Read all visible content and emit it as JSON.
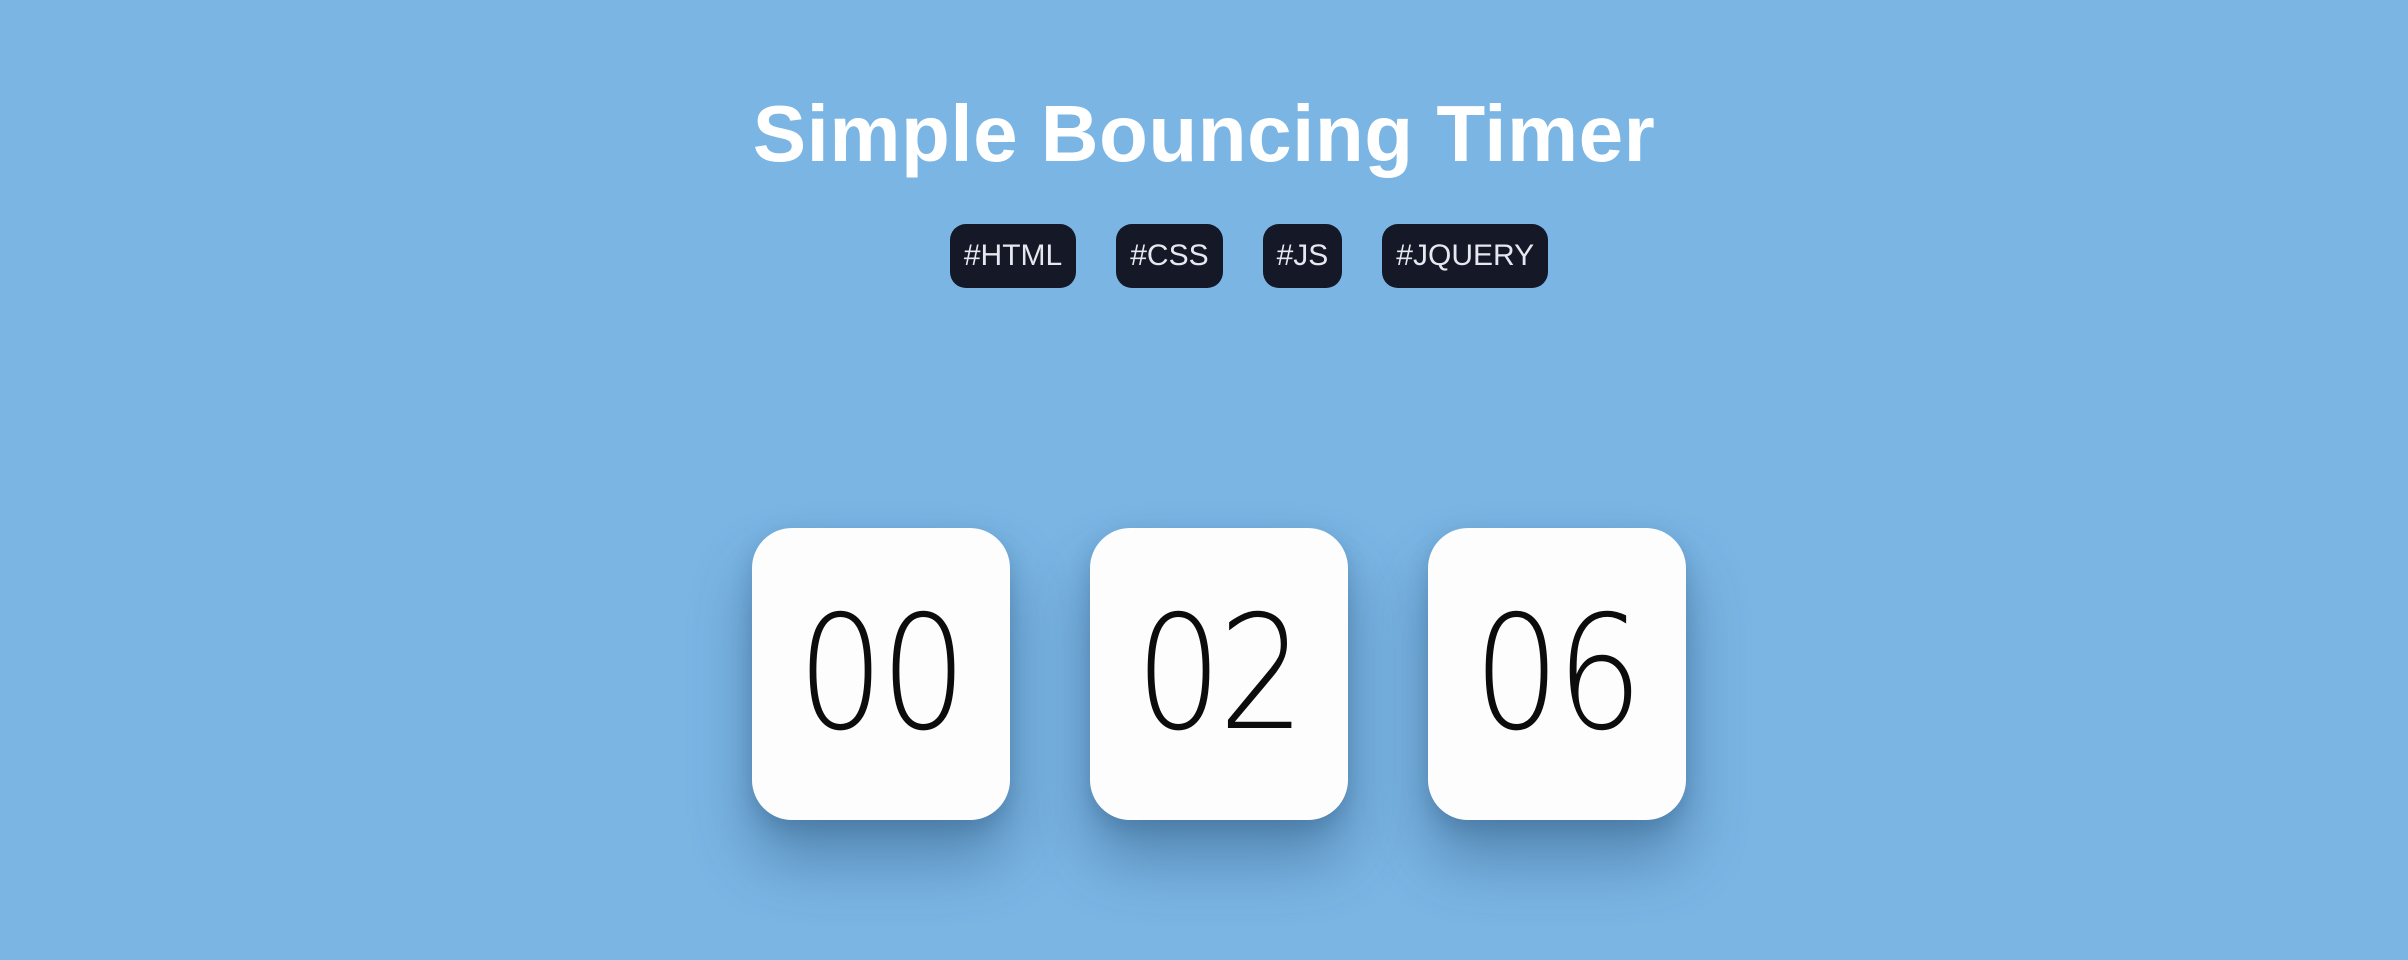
{
  "header": {
    "title": "Simple Bouncing Timer"
  },
  "tags": [
    {
      "label": "#HTML"
    },
    {
      "label": "#CSS"
    },
    {
      "label": "#JS"
    },
    {
      "label": "#JQUERY"
    }
  ],
  "timer": {
    "hours": "00",
    "minutes": "02",
    "seconds": "06"
  },
  "colors": {
    "background": "#7ab5e4",
    "tag_background": "#141827",
    "card_background": "#fdfdfd",
    "title_text": "#ffffff"
  }
}
